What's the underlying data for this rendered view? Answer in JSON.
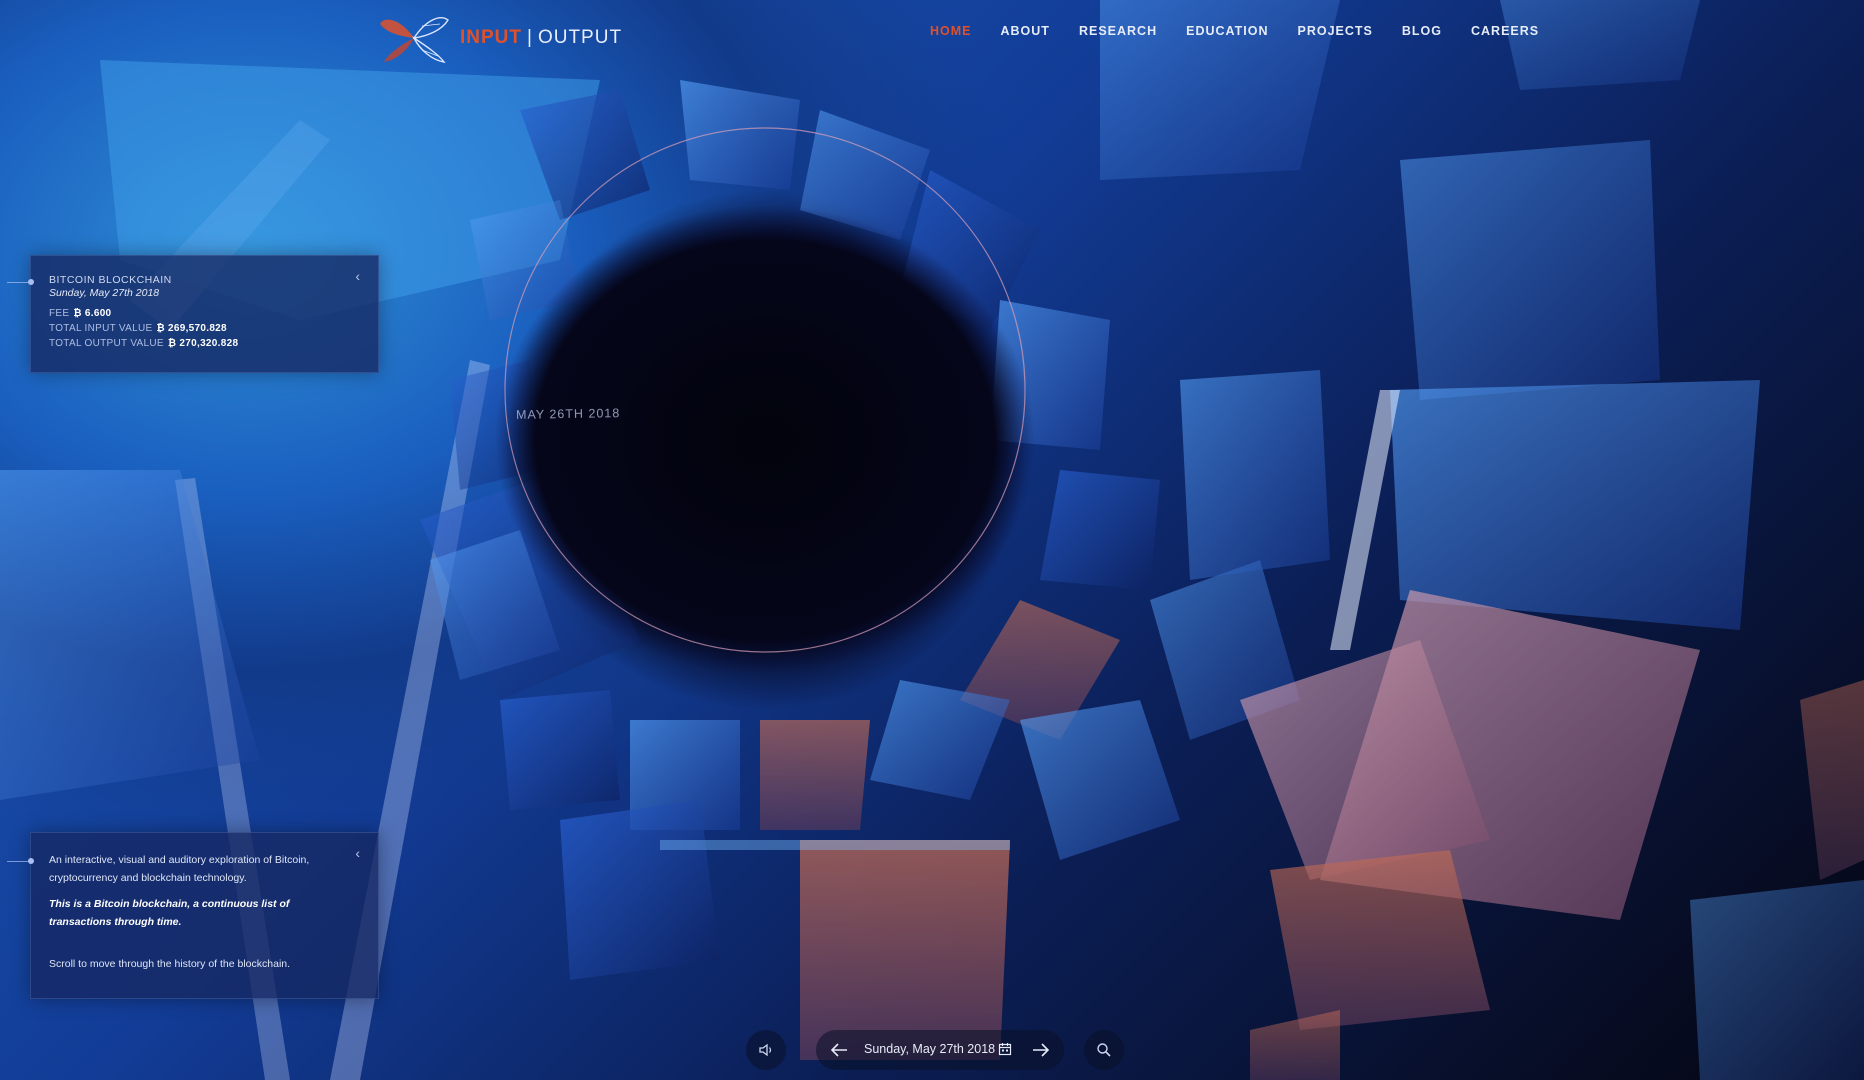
{
  "header": {
    "logo": {
      "input_text": "INPUT",
      "separator": "|",
      "output_text": "OUTPUT"
    },
    "nav": [
      {
        "label": "HOME",
        "active": true
      },
      {
        "label": "ABOUT",
        "active": false
      },
      {
        "label": "RESEARCH",
        "active": false
      },
      {
        "label": "EDUCATION",
        "active": false
      },
      {
        "label": "PROJECTS",
        "active": false
      },
      {
        "label": "BLOG",
        "active": false
      },
      {
        "label": "CAREERS",
        "active": false
      }
    ]
  },
  "block_info": {
    "title": "BITCOIN BLOCKCHAIN",
    "date": "Sunday, May 27th 2018",
    "fee_label": "FEE",
    "fee_value": "₿ 6.600",
    "input_label": "TOTAL INPUT VALUE",
    "input_value": "₿ 269,570.828",
    "output_label": "TOTAL OUTPUT VALUE",
    "output_value": "₿ 270,320.828",
    "collapse_icon": "chevron-left-icon"
  },
  "about": {
    "intro": "An interactive, visual and auditory exploration of Bitcoin, cryptocurrency and blockchain technology.",
    "emphasis": "This is a Bitcoin blockchain, a continuous list of transactions through time.",
    "hint": "Scroll to move through the history of the blockchain.",
    "collapse_icon": "chevron-left-icon"
  },
  "scene": {
    "ring_date": "MAY 26TH 2018"
  },
  "controls": {
    "sound_icon": "speaker-icon",
    "prev_icon": "arrow-left-icon",
    "current_date": "Sunday, May 27th 2018",
    "calendar_icon": "calendar-icon",
    "next_icon": "arrow-right-icon",
    "search_icon": "search-icon"
  },
  "colors": {
    "accent": "#e0512a",
    "deep_blue": "#123c96",
    "bright_blue": "#2f8fd6",
    "background": "#05050f"
  }
}
